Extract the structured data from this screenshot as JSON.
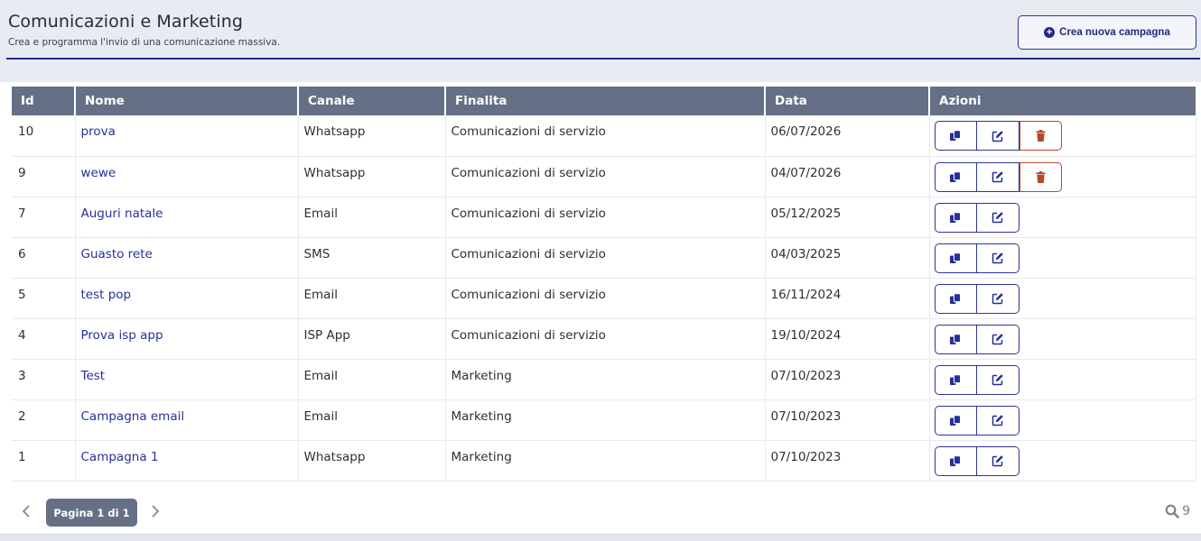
{
  "header": {
    "title": "Comunicazioni e Marketing",
    "subtitle": "Crea e programma l'invio di una comunicazione massiva.",
    "create_button": "Crea nuova campagna"
  },
  "table": {
    "columns": [
      "Id",
      "Nome",
      "Canale",
      "Finalita",
      "Data",
      "Azioni"
    ],
    "rows": [
      {
        "id": "10",
        "nome": "prova",
        "canale": "Whatsapp",
        "finalita": "Comunicazioni di servizio",
        "data": "06/07/2026"
      },
      {
        "id": "9",
        "nome": "wewe",
        "canale": "Whatsapp",
        "finalita": "Comunicazioni di servizio",
        "data": "04/07/2026"
      },
      {
        "id": "7",
        "nome": "Auguri natale",
        "canale": "Email",
        "finalita": "Comunicazioni di servizio",
        "data": "05/12/2025"
      },
      {
        "id": "6",
        "nome": "Guasto rete",
        "canale": "SMS",
        "finalita": "Comunicazioni di servizio",
        "data": "04/03/2025"
      },
      {
        "id": "5",
        "nome": "test pop",
        "canale": "Email",
        "finalita": "Comunicazioni di servizio",
        "data": "16/11/2024"
      },
      {
        "id": "4",
        "nome": "Prova isp app",
        "canale": "ISP App",
        "finalita": "Comunicazioni di servizio",
        "data": "19/10/2024"
      },
      {
        "id": "3",
        "nome": "Test",
        "canale": "Email",
        "finalita": "Marketing",
        "data": "07/10/2023"
      },
      {
        "id": "2",
        "nome": "Campagna email",
        "canale": "Email",
        "finalita": "Marketing",
        "data": "07/10/2023"
      },
      {
        "id": "1",
        "nome": "Campagna 1",
        "canale": "Whatsapp",
        "finalita": "Marketing",
        "data": "07/10/2023"
      }
    ]
  },
  "pagination": {
    "page_label": "Pagina 1 di 1",
    "total_count": "9"
  },
  "colors": {
    "primary": "#232a86",
    "header_row": "#657087",
    "delete": "#b2492a",
    "link": "#27319a"
  },
  "icons": {
    "create": "plus-circle-icon",
    "duplicate": "copy-icon",
    "edit": "edit-icon",
    "delete": "trash-icon",
    "prev": "chevron-left-icon",
    "next": "chevron-right-icon",
    "search": "search-icon"
  }
}
